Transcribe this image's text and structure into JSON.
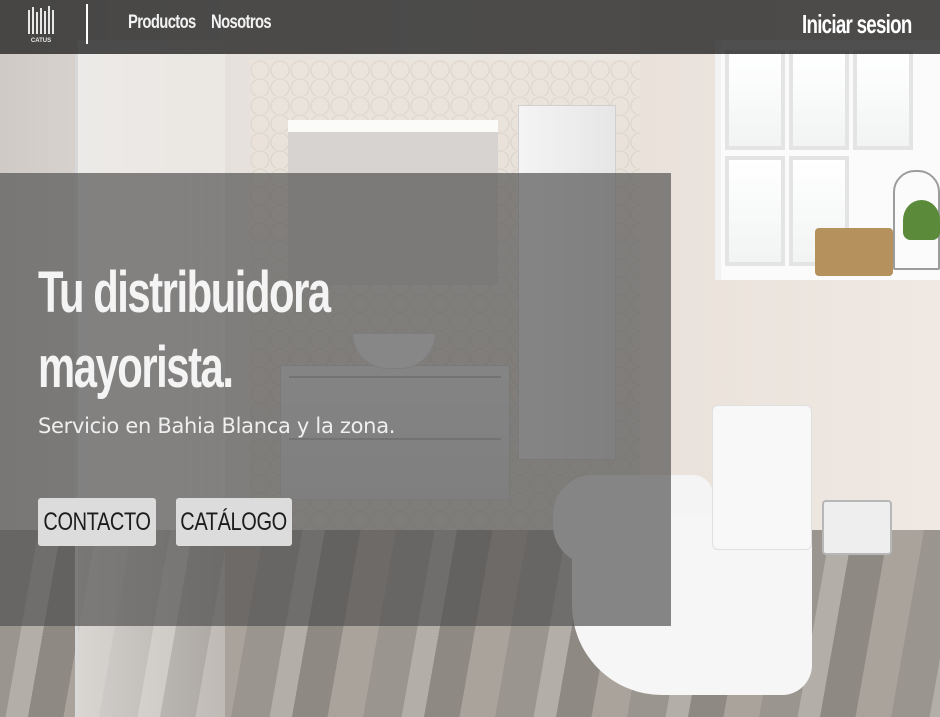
{
  "brand": {
    "logo_icon": "catus-logo-icon",
    "logo_text": "CATUS"
  },
  "nav": {
    "items": [
      {
        "label": "Productos"
      },
      {
        "label": "Nosotros"
      }
    ],
    "login_label": "Iniciar sesion"
  },
  "hero": {
    "title_line1": "Tu distribuidora",
    "title_line2": "mayorista.",
    "subtitle": "Servicio en Bahia Blanca y la zona.",
    "buttons": [
      {
        "label": "CONTACTO"
      },
      {
        "label": "CATÁLOGO"
      }
    ]
  },
  "colors": {
    "nav_bg": "#2a2a2a",
    "panel_bg": "#505050",
    "button_bg": "#dcdcdc",
    "text_light": "#f4f4f4"
  }
}
